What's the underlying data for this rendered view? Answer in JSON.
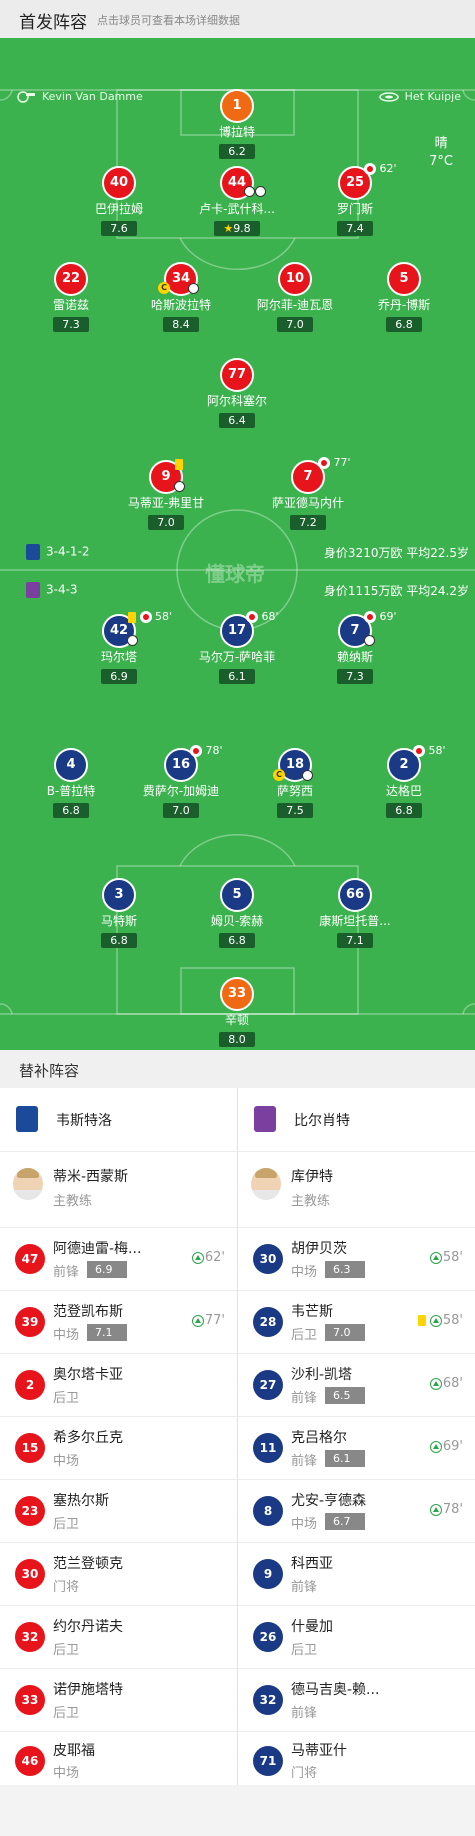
{
  "header": {
    "title": "首发阵容",
    "hint": "点击球员可查看本场详细数据"
  },
  "referee": {
    "name": "Kevin Van Damme"
  },
  "venue": {
    "name": "Het Kuipje"
  },
  "weather": {
    "condition": "晴",
    "temp": "7°C"
  },
  "watermark": "懂球帝",
  "home": {
    "formation": "3-4-1-2",
    "stats": "身价3210万欧 平均22.5岁",
    "players": [
      {
        "num": "1",
        "name": "博拉特",
        "rating": "6.2"
      },
      {
        "num": "40",
        "name": "巴伊拉姆",
        "rating": "7.6"
      },
      {
        "num": "44",
        "name": "卢卡-武什科...",
        "rating": "9.8"
      },
      {
        "num": "25",
        "name": "罗门斯",
        "rating": "7.4",
        "sub": "62'"
      },
      {
        "num": "22",
        "name": "雷诺兹",
        "rating": "7.3"
      },
      {
        "num": "34",
        "name": "哈斯波拉特",
        "rating": "8.4"
      },
      {
        "num": "10",
        "name": "阿尔菲-迪瓦恩",
        "rating": "7.0"
      },
      {
        "num": "5",
        "name": "乔丹-博斯",
        "rating": "6.8"
      },
      {
        "num": "77",
        "name": "阿尔科塞尔",
        "rating": "6.4"
      },
      {
        "num": "9",
        "name": "马蒂亚-弗里甘",
        "rating": "7.0"
      },
      {
        "num": "7",
        "name": "萨亚德马内什",
        "rating": "7.2",
        "sub": "77'"
      }
    ]
  },
  "away": {
    "formation": "3-4-3",
    "stats": "身价1115万欧 平均24.2岁",
    "players": [
      {
        "num": "42",
        "name": "玛尔塔",
        "rating": "6.9",
        "sub": "58'"
      },
      {
        "num": "17",
        "name": "马尔万-萨哈菲",
        "rating": "6.1",
        "sub": "68'"
      },
      {
        "num": "7",
        "name": "赖纳斯",
        "rating": "7.3",
        "sub": "69'"
      },
      {
        "num": "4",
        "name": "B-普拉特",
        "rating": "6.8"
      },
      {
        "num": "16",
        "name": "费萨尔-加姆迪",
        "rating": "7.0",
        "sub": "78'"
      },
      {
        "num": "18",
        "name": "萨努西",
        "rating": "7.5"
      },
      {
        "num": "2",
        "name": "达格巴",
        "rating": "6.8",
        "sub": "58'"
      },
      {
        "num": "3",
        "name": "马特斯",
        "rating": "6.8"
      },
      {
        "num": "5",
        "name": "姆贝-索赫",
        "rating": "6.8"
      },
      {
        "num": "66",
        "name": "康斯坦托普...",
        "rating": "7.1"
      },
      {
        "num": "33",
        "name": "辛顿",
        "rating": "8.0"
      }
    ]
  },
  "subs": {
    "title": "替补阵容",
    "home": {
      "team": "韦斯特洛",
      "coach": {
        "name": "蒂米-西蒙斯",
        "role": "主教练"
      },
      "players": [
        {
          "num": "47",
          "name": "阿德迪雷-梅...",
          "pos": "前锋",
          "rating": "6.9",
          "min": "62'"
        },
        {
          "num": "39",
          "name": "范登凯布斯",
          "pos": "中场",
          "rating": "7.1",
          "min": "77'"
        },
        {
          "num": "2",
          "name": "奥尔塔卡亚",
          "pos": "后卫"
        },
        {
          "num": "15",
          "name": "希多尔丘克",
          "pos": "中场"
        },
        {
          "num": "23",
          "name": "塞热尔斯",
          "pos": "后卫"
        },
        {
          "num": "30",
          "name": "范兰登顿克",
          "pos": "门将"
        },
        {
          "num": "32",
          "name": "约尔丹诺夫",
          "pos": "后卫"
        },
        {
          "num": "33",
          "name": "诺伊施塔特",
          "pos": "后卫"
        },
        {
          "num": "46",
          "name": "皮耶福",
          "pos": "中场"
        }
      ]
    },
    "away": {
      "team": "比尔肖特",
      "coach": {
        "name": "库伊特",
        "role": "主教练"
      },
      "players": [
        {
          "num": "30",
          "name": "胡伊贝茨",
          "pos": "中场",
          "rating": "6.3",
          "min": "58'"
        },
        {
          "num": "28",
          "name": "韦芒斯",
          "pos": "后卫",
          "rating": "7.0",
          "min": "58'",
          "card": "yellow"
        },
        {
          "num": "27",
          "name": "沙利-凯塔",
          "pos": "前锋",
          "rating": "6.5",
          "min": "68'"
        },
        {
          "num": "11",
          "name": "克吕格尔",
          "pos": "前锋",
          "rating": "6.1",
          "min": "69'"
        },
        {
          "num": "8",
          "name": "尤安-亨德森",
          "pos": "中场",
          "rating": "6.7",
          "min": "78'"
        },
        {
          "num": "9",
          "name": "科西亚",
          "pos": "前锋"
        },
        {
          "num": "26",
          "name": "什曼加",
          "pos": "后卫"
        },
        {
          "num": "32",
          "name": "德马吉奥-赖...",
          "pos": "前锋"
        },
        {
          "num": "71",
          "name": "马蒂亚什",
          "pos": "门将"
        }
      ]
    }
  },
  "colors": {
    "pitch": "#3bb24e",
    "home": "#e8141c",
    "away": "#1b3a86",
    "gk": "#f06a14"
  }
}
